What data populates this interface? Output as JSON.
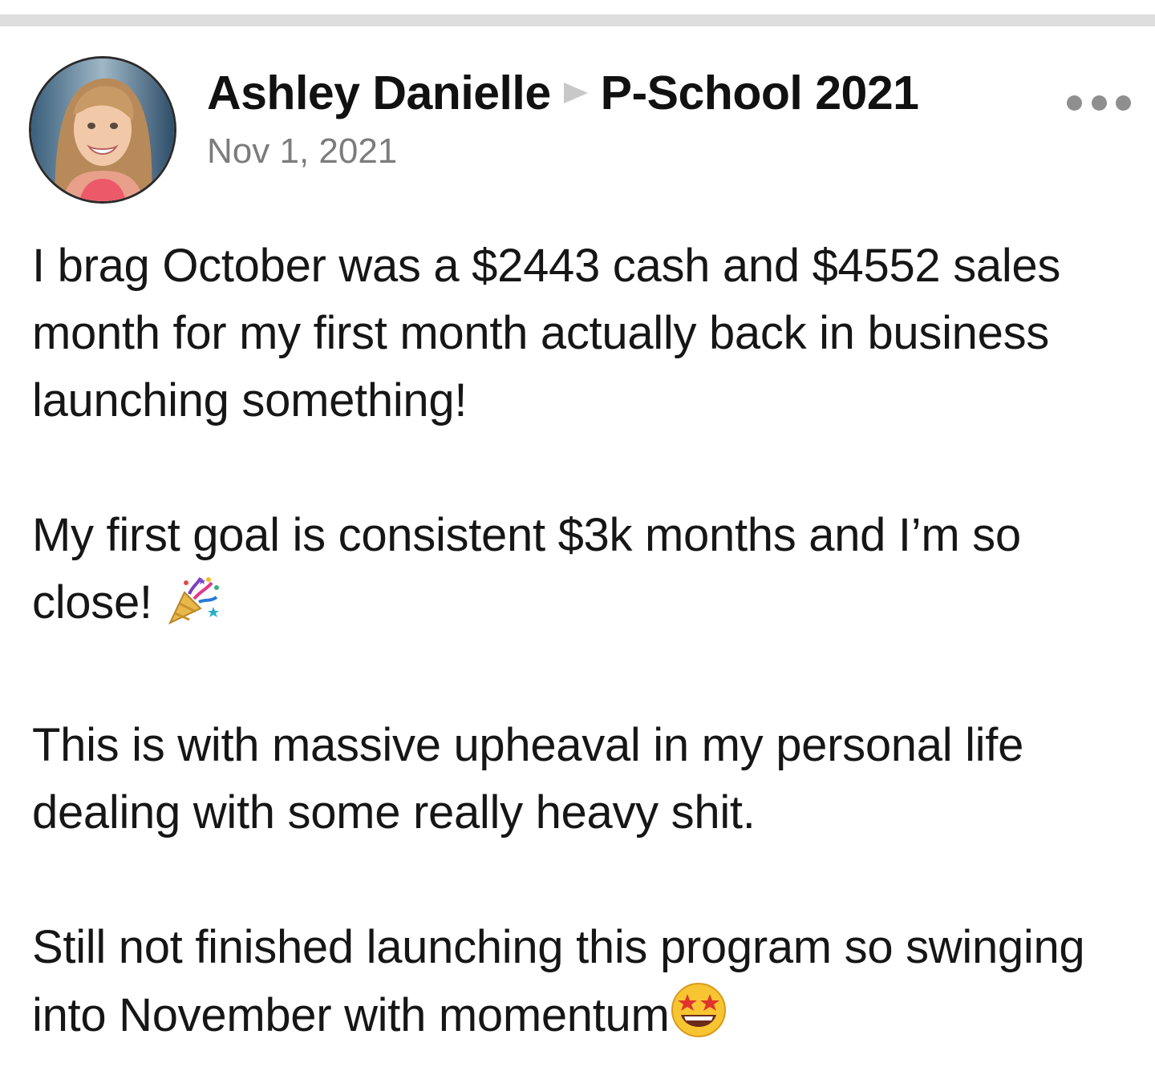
{
  "post": {
    "author": "Ashley Danielle",
    "group": "P-School 2021",
    "date": "Nov 1, 2021",
    "avatar_icon": "profile-photo",
    "share_icon": "right-triangle-icon",
    "menu_icon": "more-horizontal-icon"
  },
  "body": {
    "paragraphs": [
      "I brag October was a $2443 cash and $4552 sales month for my first month actually back in business launching something!",
      "My first goal is consistent $3k months and I’m so close!",
      "This is with massive upheaval in my personal life dealing with some really heavy shit.",
      "Still not finished launching this program so swinging into November with momentum"
    ],
    "emojis": {
      "party_popper": "party-popper-icon",
      "star_struck": "star-struck-icon"
    }
  },
  "colors": {
    "divider": "#dedede",
    "name_text": "#111111",
    "date_text": "#7c7c7c",
    "menu_dots": "#8f8f8f",
    "share_arrow": "#c8c8c8"
  }
}
